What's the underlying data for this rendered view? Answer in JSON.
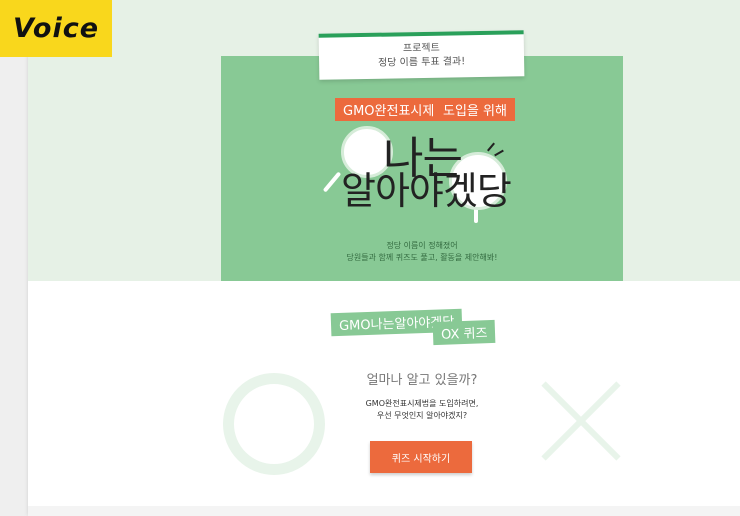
{
  "badge": {
    "label": "Voice"
  },
  "poster": {
    "tab_line1": "프로젝트",
    "tab_line2": "정당 이름 투표 결과!",
    "orange_line1": "GMO완전표시제법",
    "orange_line2": "도입을 위해",
    "title_line1": "나는",
    "title_line2": "알아야겠당",
    "desc_line1": "정당 이름이 정해졌어",
    "desc_line2": "당원들과 함께 퀴즈도 풀고, 활동을 제안해봐!"
  },
  "quiz": {
    "label_line1": "GMO나는알아야겠당",
    "label_line2": "OX 퀴즈",
    "question": "얼마나 알고 있을까?",
    "sub_line1": "GMO완전표시제법을 도입하려면,",
    "sub_line2": "우선 무엇인지 알아야겠지?",
    "button_label": "퀴즈 시작하기"
  },
  "colors": {
    "accent_orange": "#ec6a3d",
    "poster_green": "#88c995",
    "badge_yellow": "#f9d71c"
  }
}
